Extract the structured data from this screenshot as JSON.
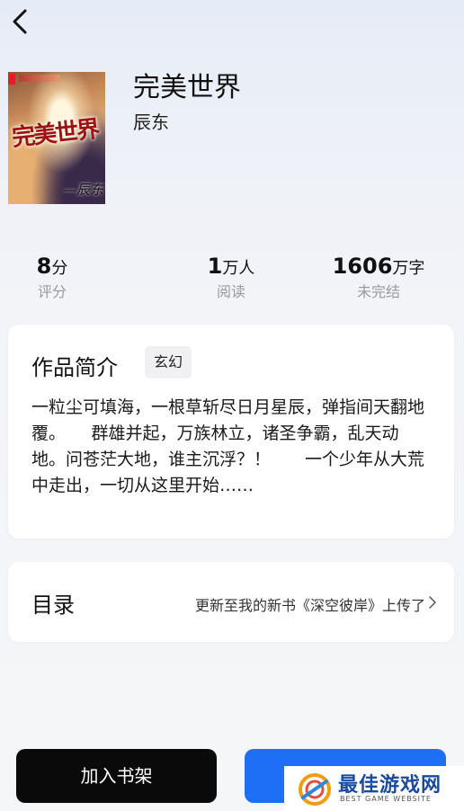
{
  "header": {
    "back_icon": "chevron-left-icon"
  },
  "book": {
    "cover_title": "完美世界",
    "cover_author": "—辰东",
    "title": "完美世界",
    "author": "辰东"
  },
  "stats": [
    {
      "value": "8",
      "unit": "分",
      "label": "评分"
    },
    {
      "value": "1",
      "unit": "万人",
      "label": "阅读"
    },
    {
      "value": "1606",
      "unit": "万字",
      "label": "未完结"
    }
  ],
  "intro": {
    "heading": "作品简介",
    "genre": "玄幻",
    "text": "一粒尘可填海，一根草斩尽日月星辰，弹指间天翻地覆。　　群雄并起，万族林立，诸圣争霸，乱天动地。问苍茫大地，谁主沉浮？！　　一个少年从大荒中走出，一切从这里开始……"
  },
  "toc": {
    "label": "目录",
    "update": "更新至我的新书《深空彼岸》上传了",
    "chevron_icon": "chevron-right-icon"
  },
  "actions": {
    "add_shelf": "加入书架",
    "read": ""
  },
  "watermark": {
    "main": "最佳游戏网",
    "sub": "BEST GAME WEBSITE"
  },
  "colors": {
    "primary_blue": "#1e6ff5",
    "black_button": "#0a0a0a",
    "muted_text": "#9a9a9a"
  }
}
